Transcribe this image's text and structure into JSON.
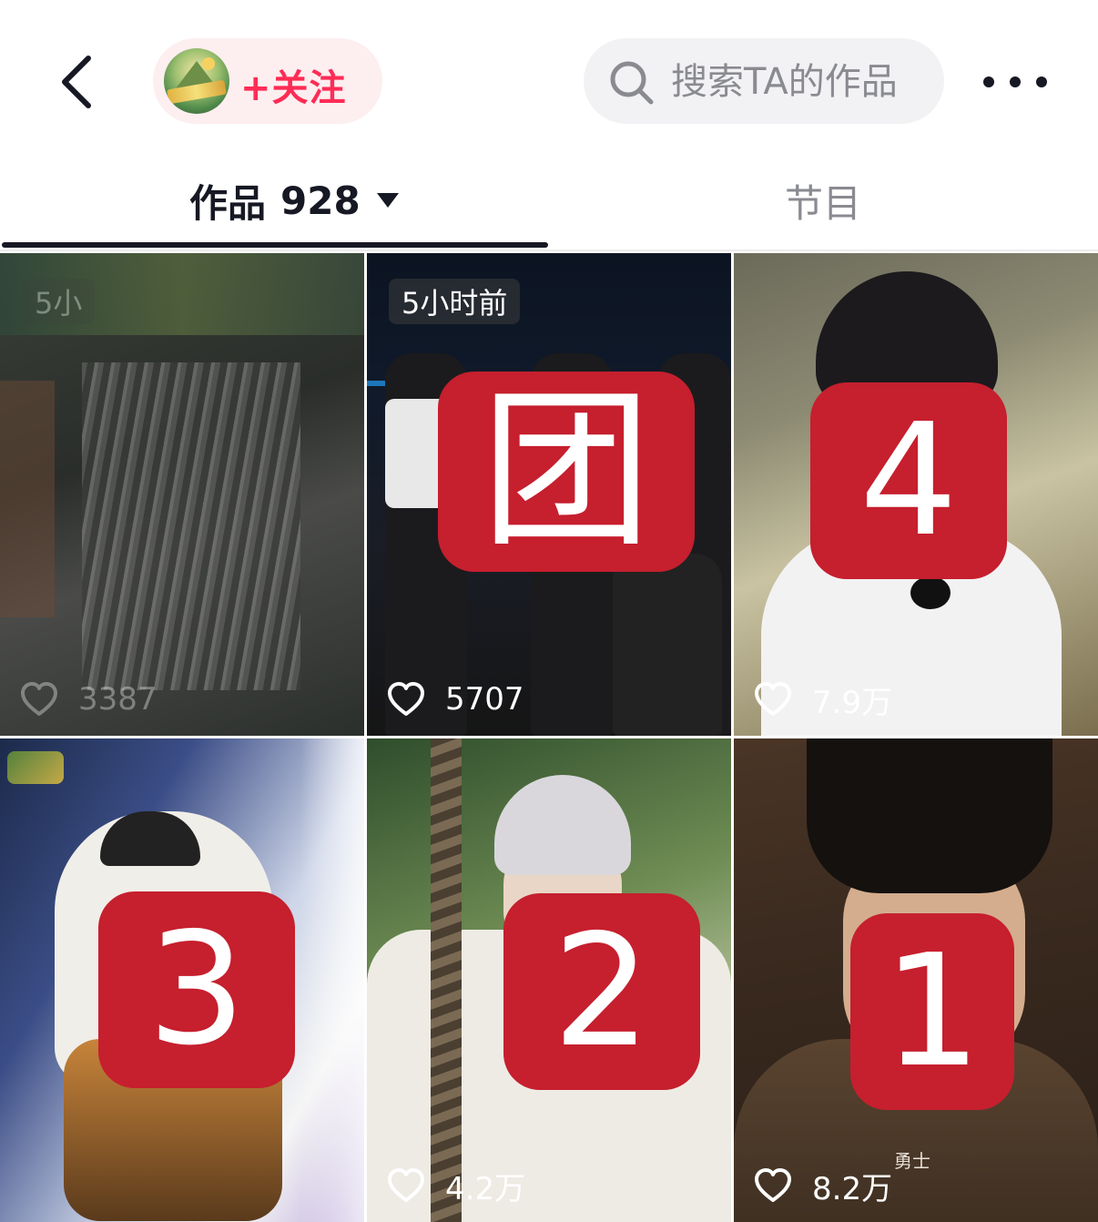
{
  "topbar": {
    "follow_label": "+关注",
    "search_placeholder": "搜索TA的作品"
  },
  "tabs": {
    "works_label": "作品",
    "works_count": "928",
    "shows_label": "节目"
  },
  "videos": [
    {
      "time_ago": "5小",
      "likes": "3387",
      "blurred": true
    },
    {
      "time_ago": "5小时前",
      "likes": "5707",
      "overlay_tag": "团"
    },
    {
      "likes": "7.9万",
      "overlay_tag": "4"
    },
    {
      "likes": "",
      "overlay_tag": "3"
    },
    {
      "likes": "4.2万",
      "overlay_tag": "2"
    },
    {
      "likes": "8.2万",
      "overlay_tag": "1",
      "watermark": "勇士"
    }
  ],
  "colors": {
    "accent": "#fe2c55",
    "follow_bg": "#fdeef0",
    "tag_red": "#c61f2e",
    "search_bg": "#f2f2f4",
    "muted_text": "#8a8b91"
  },
  "icons": [
    "back-arrow-icon",
    "avatar-logo",
    "search-icon",
    "more-dots-icon",
    "dropdown-caret-icon",
    "heart-icon"
  ]
}
